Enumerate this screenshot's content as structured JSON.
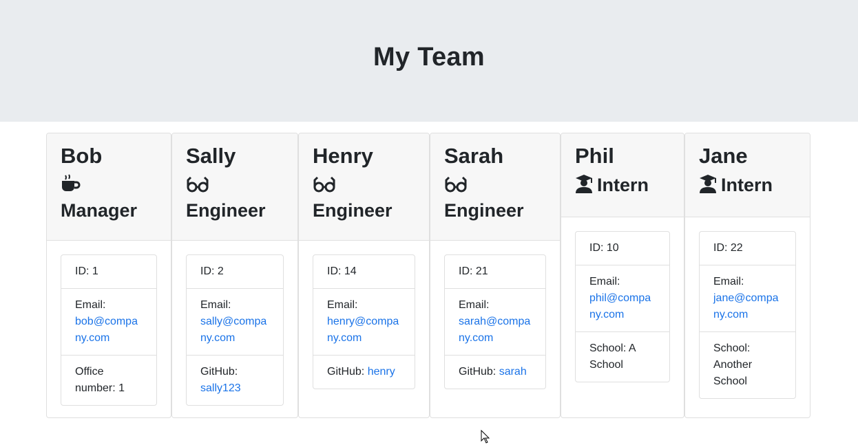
{
  "header": {
    "title": "My Team"
  },
  "members": [
    {
      "name": "Bob",
      "role": "Manager",
      "icon": "coffee-icon",
      "id_text": "ID: 1",
      "email_label": "Email:",
      "email": "bob@company.com",
      "extra_label": "Office number: 1",
      "extra_link": ""
    },
    {
      "name": "Sally",
      "role": "Engineer",
      "icon": "glasses-icon",
      "id_text": "ID: 2",
      "email_label": "Email:",
      "email": "sally@company.com",
      "extra_label": "GitHub:",
      "extra_link": "sally123"
    },
    {
      "name": "Henry",
      "role": "Engineer",
      "icon": "glasses-icon",
      "id_text": "ID: 14",
      "email_label": "Email:",
      "email": "henry@company.com",
      "extra_label": "GitHub:",
      "extra_link": "henry"
    },
    {
      "name": "Sarah",
      "role": "Engineer",
      "icon": "glasses-icon",
      "id_text": "ID: 21",
      "email_label": "Email:",
      "email": "sarah@company.com",
      "extra_label": "GitHub:",
      "extra_link": "sarah"
    },
    {
      "name": "Phil",
      "role": "Intern",
      "icon": "graduate-icon",
      "id_text": "ID: 10",
      "email_label": "Email:",
      "email": "phil@company.com",
      "extra_label": "School: A School",
      "extra_link": ""
    },
    {
      "name": "Jane",
      "role": "Intern",
      "icon": "graduate-icon",
      "id_text": "ID: 22",
      "email_label": "Email:",
      "email": "jane@company.com",
      "extra_label": "School: Another School",
      "extra_link": ""
    }
  ],
  "colors": {
    "header_bg": "#e9ecef",
    "link": "#1a73e8",
    "card_header_bg": "#f7f7f7"
  }
}
